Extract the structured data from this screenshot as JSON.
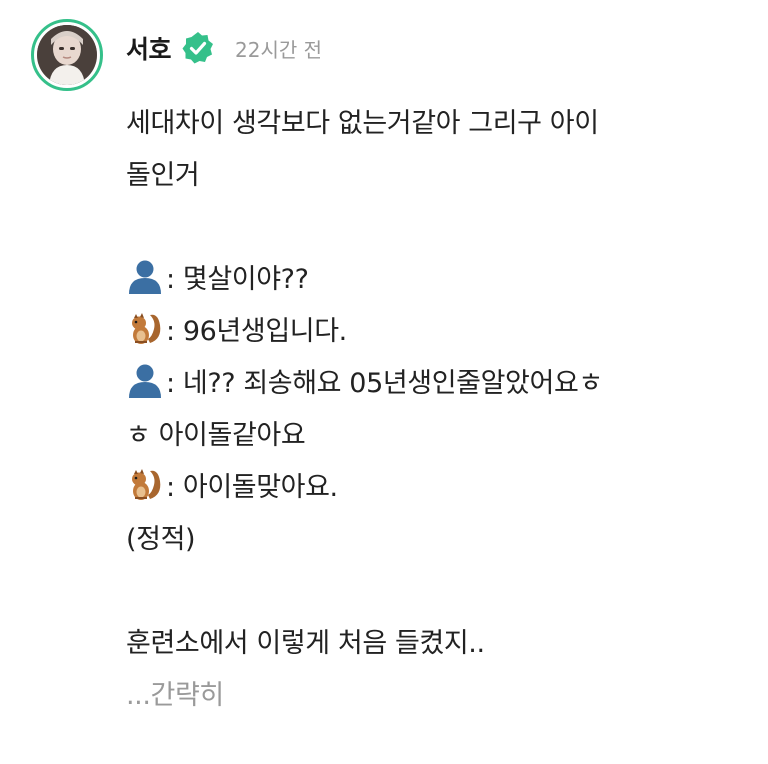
{
  "post": {
    "author": "서호",
    "timestamp": "22시간 전",
    "lines": [
      "세대차이 생각보다 없는거같아 그리구 아이",
      "돌인거",
      "",
      ": 몇살이야??",
      ": 96년생입니다.",
      ": 네?? 죄송해요 05년생인줄알았어요ㅎ",
      "ㅎ 아이돌같아요",
      ": 아이돌맞아요.",
      "(정적)",
      "",
      "훈련소에서 이렇게 처음 들켰지.."
    ],
    "collapse_label": "...간략히"
  },
  "colors": {
    "accent_green": "#35c08a",
    "text": "#222222",
    "muted": "#9a9a9a"
  },
  "icons": {
    "verified": "verified-check-icon",
    "person": "person-silhouette-emoji",
    "squirrel": "chipmunk-emoji"
  }
}
